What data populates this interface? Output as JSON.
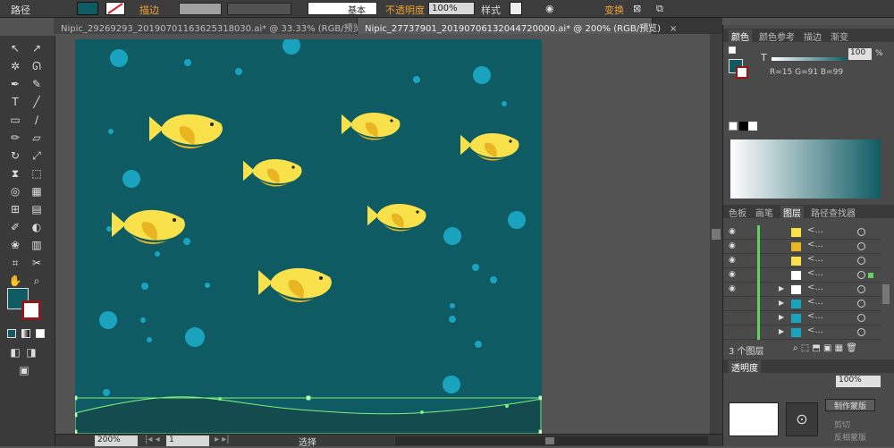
{
  "topbar": {
    "path_label": "路径",
    "stroke_label": "描边",
    "stroke_style": "基本",
    "opacity_label": "不透明度",
    "opacity_value": "100%",
    "style_label": "样式",
    "transform_label": "变换"
  },
  "tabs": [
    {
      "label": "Nipic_29269293_20190701163625318030.ai* @ 33.33% (RGB/预览)",
      "close": "×"
    },
    {
      "label": "Nipic_27737901_20190706132044720000.ai* @ 200% (RGB/预览)",
      "close": "×"
    }
  ],
  "statusbar": {
    "zoom": "200%",
    "page": "1",
    "mode": "选择"
  },
  "color_panel": {
    "tabs": [
      "颜色",
      "颜色参考",
      "描边",
      "渐变"
    ],
    "channel": "T",
    "tint_value": "100",
    "percent": "%",
    "rgb_readout": "R=15 G=91 B=99",
    "fill_color": "#0f5b63",
    "gradient_start": "#ffffff",
    "gradient_end": "#0f5b63"
  },
  "layers_panel": {
    "tabs": [
      "色板",
      "画笔",
      "图层",
      "路径查找器"
    ],
    "row_label": "<...",
    "layer_count": "3 个图层"
  },
  "transparency_panel": {
    "title": "透明度",
    "opacity_value": "100%",
    "make_mask_button": "制作蒙版",
    "clip_label": "剪切",
    "invert_label": "反相蒙版"
  },
  "colors": {
    "ocean": "#0f5b63",
    "bubble": "#1aa3bf",
    "fish_body": "#f9e14b",
    "fish_dark": "#e9b522",
    "ground": "#134b4f",
    "selection": "#7df07d"
  }
}
